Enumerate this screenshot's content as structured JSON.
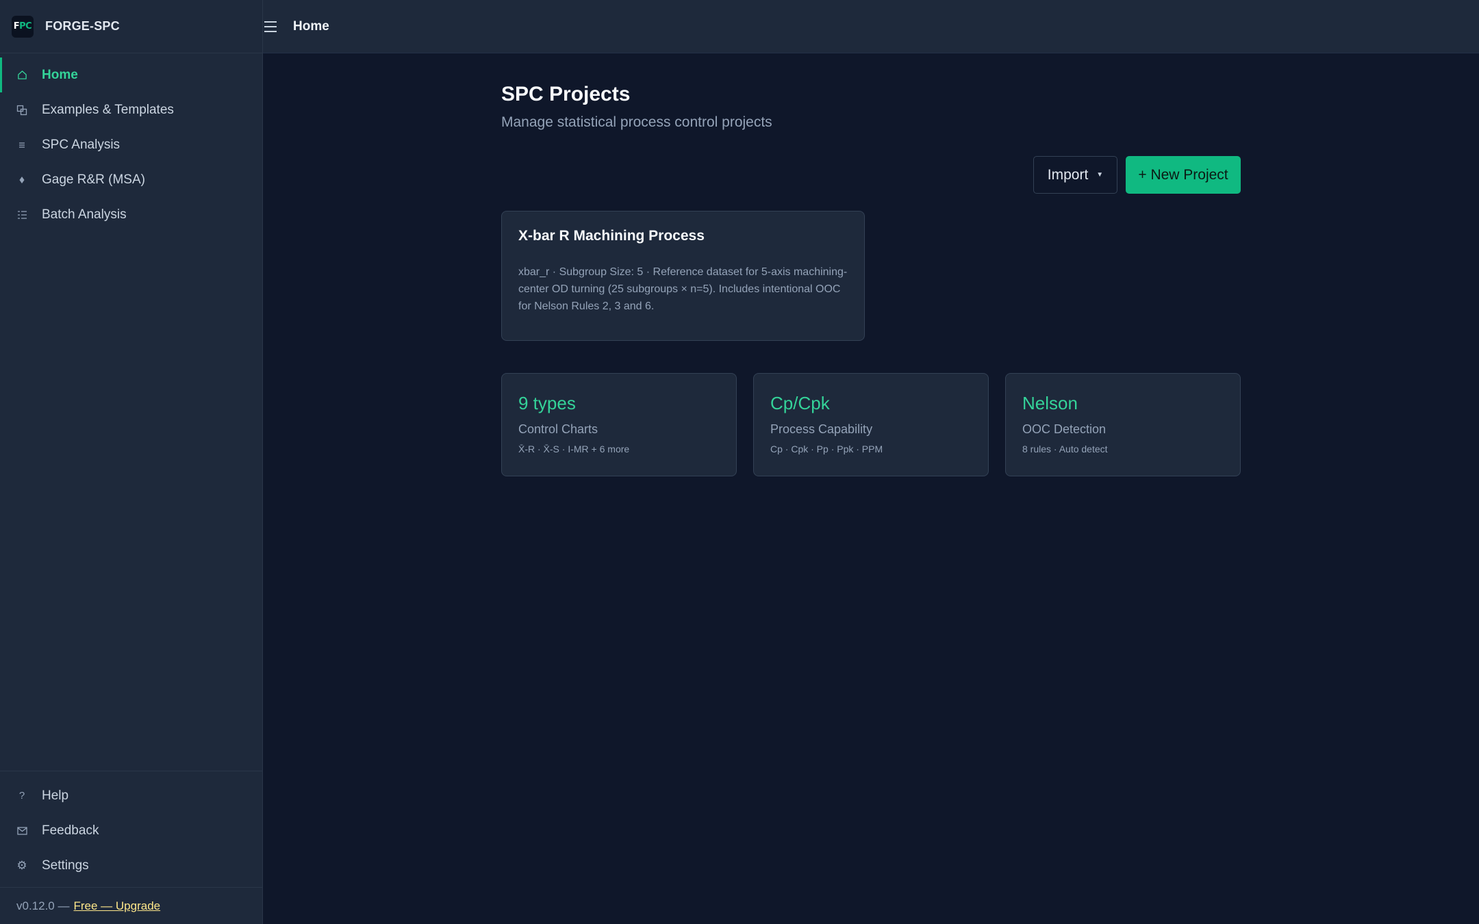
{
  "app": {
    "logo_f": "F",
    "logo_pc": "PC",
    "name": "FORGE-SPC"
  },
  "topbar": {
    "title": "Home"
  },
  "sidebar": {
    "items": [
      {
        "label": "Home",
        "icon": "home-icon"
      },
      {
        "label": "Examples & Templates",
        "icon": "templates-icon"
      },
      {
        "label": "SPC Analysis",
        "icon": "list-icon"
      },
      {
        "label": "Gage R&R (MSA)",
        "icon": "diamond-icon"
      },
      {
        "label": "Batch Analysis",
        "icon": "batch-list-icon"
      }
    ],
    "bottom": [
      {
        "label": "Help",
        "icon": "help-icon"
      },
      {
        "label": "Feedback",
        "icon": "mail-icon"
      },
      {
        "label": "Settings",
        "icon": "gear-icon"
      }
    ],
    "version": "v0.12.0 —",
    "upgrade_link": "Free — Upgrade"
  },
  "main": {
    "title": "SPC Projects",
    "subtitle": "Manage statistical process control projects",
    "import_label": "Import",
    "new_project_label": "+ New Project",
    "project": {
      "title": "X-bar R Machining Process",
      "description": "xbar_r · Subgroup Size: 5  · Reference dataset for 5-axis machining-center OD turning (25 subgroups × n=5). Includes intentional OOC for Nelson Rules 2, 3 and 6."
    },
    "stats": [
      {
        "value": "9 types",
        "label": "Control Charts",
        "detail": "X̄-R · X̄-S · I-MR + 6 more"
      },
      {
        "value": "Cp/Cpk",
        "label": "Process Capability",
        "detail": "Cp · Cpk · Pp · Ppk · PPM"
      },
      {
        "value": "Nelson",
        "label": "OOC Detection",
        "detail": "8 rules · Auto detect"
      }
    ]
  },
  "colors": {
    "accent": "#10b981",
    "accent_text": "#34d399",
    "background": "#0f172a",
    "panel": "#1e293b"
  }
}
